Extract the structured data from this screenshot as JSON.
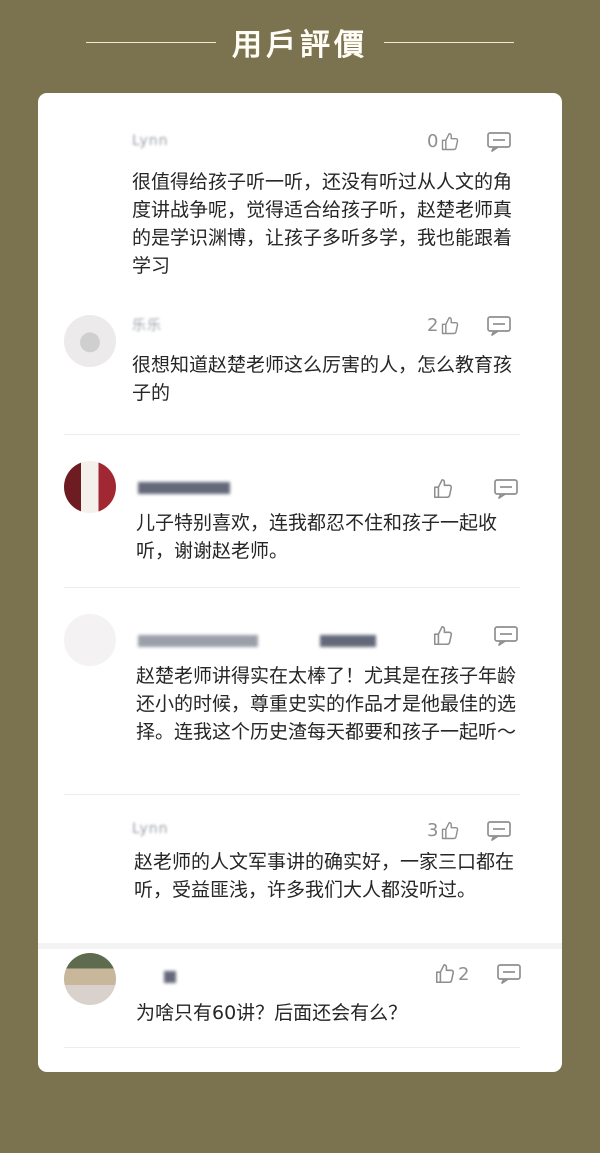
{
  "header": {
    "title": "用戶評價"
  },
  "comments": [
    {
      "username": "Lynn",
      "likes": "0",
      "text": "很值得给孩子听一听，还没有听过从人文的角度讲战争呢，觉得适合给孩子听，赵楚老师真的是学识渊博，让孩子多听多学，我也能跟着学习"
    },
    {
      "username": "乐乐",
      "likes": "2",
      "text": "很想知道赵楚老师这么厉害的人，怎么教育孩子的"
    },
    {
      "username": "",
      "likes": "",
      "text": "儿子特别喜欢，连我都忍不住和孩子一起收听，谢谢赵老师。"
    },
    {
      "username": "",
      "likes": "",
      "text": "赵楚老师讲得实在太棒了！尤其是在孩子年龄还小的时候，尊重史实的作品才是他最佳的选择。连我这个历史渣每天都要和孩子一起听～"
    },
    {
      "username": "Lynn",
      "likes": "3",
      "text": "赵老师的人文军事讲的确实好，一家三口都在听，受益匪浅，许多我们大人都没听过。"
    },
    {
      "username": "",
      "likes": "2",
      "text": "为啥只有60讲？后面还会有么？"
    }
  ],
  "icons": {
    "like": "thumbs-up-icon",
    "reply": "comment-icon",
    "default_avatar": "user-icon"
  },
  "colors": {
    "background": "#7b734f",
    "card": "#ffffff",
    "icon": "#8f8f8f"
  }
}
